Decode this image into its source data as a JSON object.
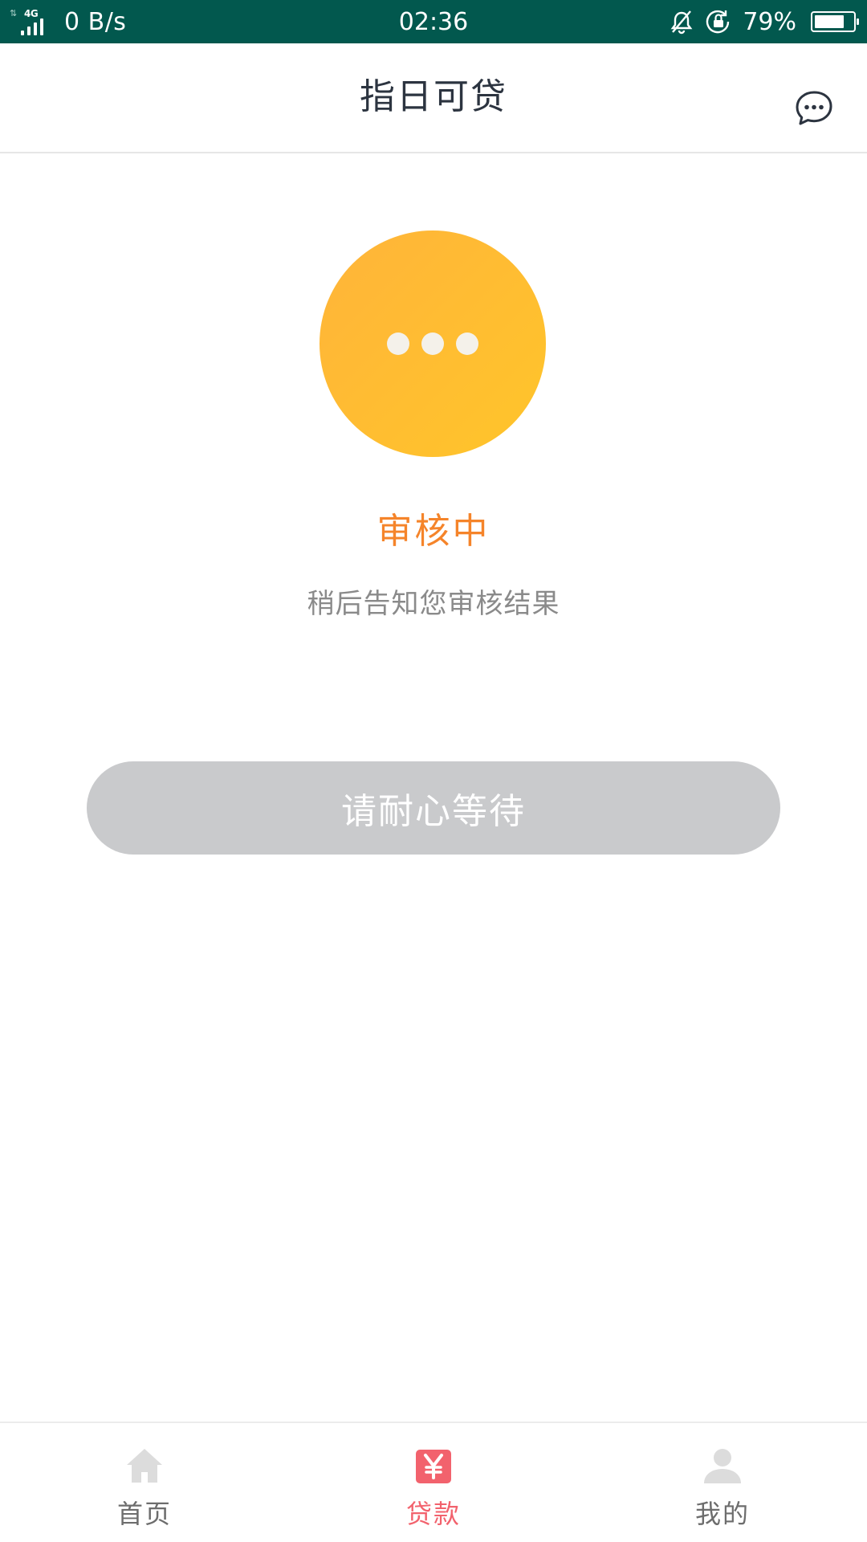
{
  "status_bar": {
    "network_type": "4G",
    "net_speed": "0 B/s",
    "time": "02:36",
    "battery_percent_text": "79%",
    "battery_level": 0.79
  },
  "header": {
    "title": "指日可贷",
    "message_icon": "chat-bubble-icon"
  },
  "review": {
    "status_icon": "pending-dots-icon",
    "status_title": "审核中",
    "status_subtitle": "稍后告知您审核结果",
    "button_label": "请耐心等待"
  },
  "bottom_nav": {
    "items": [
      {
        "label": "首页",
        "icon": "home-icon",
        "active": false
      },
      {
        "label": "贷款",
        "icon": "yuan-icon",
        "active": true
      },
      {
        "label": "我的",
        "icon": "person-icon",
        "active": false
      }
    ]
  },
  "colors": {
    "status_bar_bg": "#02584e",
    "circle_start": "#ffb43a",
    "circle_end": "#ffc52a",
    "status_title": "#f5842a",
    "button_bg": "#c9cacc",
    "nav_active": "#f2626d",
    "nav_inactive_icon": "#dcdcdc"
  }
}
